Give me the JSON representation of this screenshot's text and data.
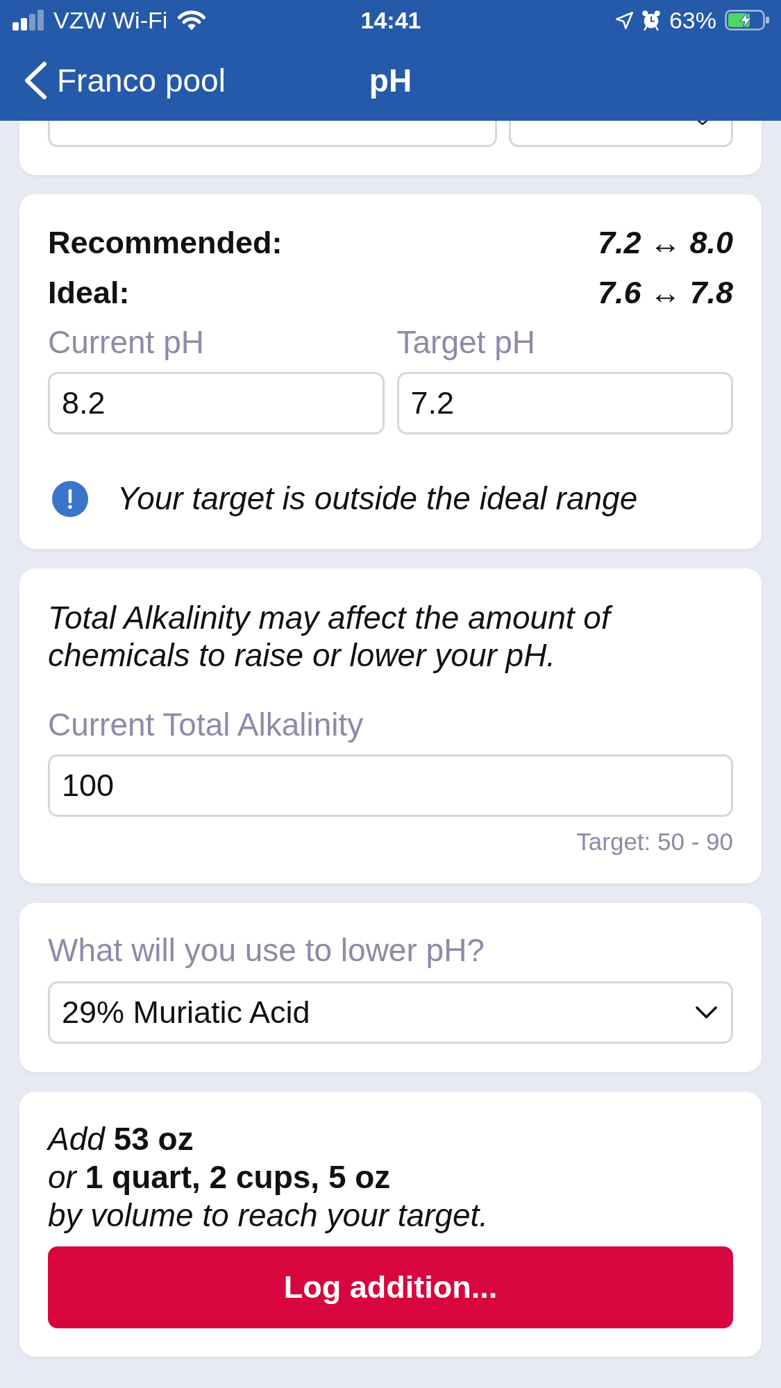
{
  "status_bar": {
    "carrier": "VZW Wi-Fi",
    "time": "14:41",
    "battery": "63%"
  },
  "nav_bar": {
    "back_label": "Franco pool",
    "title": "pH"
  },
  "volume_card": {
    "fields": [
      {
        "kind": "text"
      },
      {
        "kind": "dropdown"
      }
    ]
  },
  "ranges_card": {
    "ranges": [
      {
        "label": "Recommended:",
        "value": "7.2 ↔ 8.0"
      },
      {
        "label": "Ideal:",
        "value": "7.6 ↔ 7.8"
      }
    ],
    "fields": [
      {
        "label": "Current pH",
        "value": "8.2"
      },
      {
        "label": "Target pH",
        "value": "7.2"
      }
    ],
    "alert": "Your target is outside the ideal range"
  },
  "alkalinity_card": {
    "note": "Total Alkalinity may affect the amount of chemicals to raise or lower your pH.",
    "field": {
      "label": "Current Total Alkalinity",
      "value": "100"
    },
    "hint": "Target: 50 - 90"
  },
  "chemical_card": {
    "label": "What will you use to lower pH?",
    "select": "29% Muriatic Acid"
  },
  "result_card": {
    "dosage_lines": [
      "Add **53 oz**",
      "or **1 quart, 2 cups, 5 oz**",
      "by volume to reach your target."
    ],
    "button": "Log addition..."
  }
}
